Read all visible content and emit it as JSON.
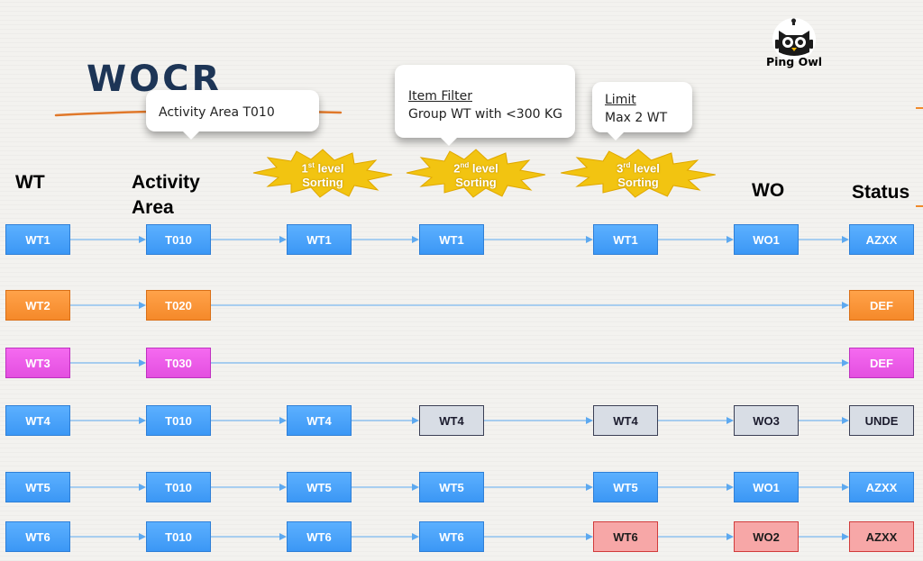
{
  "title": "WOCR",
  "logo": {
    "text": "Ping Owl"
  },
  "headers": {
    "wt": "WT",
    "activity_line1": "Activity",
    "activity_line2": "Area",
    "wo": "WO",
    "status": "Status"
  },
  "callouts": {
    "activity_area": {
      "text": "Activity Area T010"
    },
    "item_filter": {
      "heading": "Item Filter",
      "text": "Group WT with <300 KG"
    },
    "limit": {
      "heading": "Limit",
      "text": "Max 2 WT"
    }
  },
  "bursts": [
    {
      "ord": "1",
      "sup": "st",
      "word1": "level",
      "word2": "Sorting"
    },
    {
      "ord": "2",
      "sup": "nd",
      "word1": "level",
      "word2": "Sorting"
    },
    {
      "ord": "3",
      "sup": "rd",
      "word1": "level",
      "word2": "Sorting"
    }
  ],
  "colors": {
    "blue": "#4aa3fb",
    "orange": "#f7922f",
    "magenta": "#e85be6",
    "gray": "#d8dde5",
    "red": "#f7a7a7",
    "connector": "#5da9f0",
    "burst": "#f2c411"
  },
  "rows": [
    {
      "wt": "WT1",
      "area": "T010",
      "sort1": "WT1",
      "sort2": "WT1",
      "sort3": "WT1",
      "wo": "WO1",
      "status": "AZXX",
      "color": "blue",
      "sort2_color": "blue",
      "sort3_color": "blue",
      "wo_color": "blue",
      "status_color": "blue"
    },
    {
      "wt": "WT2",
      "area": "T020",
      "status": "DEF",
      "color": "orange",
      "status_color": "orange"
    },
    {
      "wt": "WT3",
      "area": "T030",
      "status": "DEF",
      "color": "magenta",
      "status_color": "magenta"
    },
    {
      "wt": "WT4",
      "area": "T010",
      "sort1": "WT4",
      "sort2": "WT4",
      "sort3": "WT4",
      "wo": "WO3",
      "status": "UNDE",
      "color": "blue",
      "sort2_color": "gray",
      "sort3_color": "gray",
      "wo_color": "gray",
      "status_color": "gray"
    },
    {
      "wt": "WT5",
      "area": "T010",
      "sort1": "WT5",
      "sort2": "WT5",
      "sort3": "WT5",
      "wo": "WO1",
      "status": "AZXX",
      "color": "blue",
      "sort2_color": "blue",
      "sort3_color": "blue",
      "wo_color": "blue",
      "status_color": "blue"
    },
    {
      "wt": "WT6",
      "area": "T010",
      "sort1": "WT6",
      "sort2": "WT6",
      "sort3": "WT6",
      "wo": "WO2",
      "status": "AZXX",
      "color": "blue",
      "sort2_color": "blue",
      "sort3_color": "red",
      "wo_color": "red",
      "status_color": "red"
    }
  ]
}
